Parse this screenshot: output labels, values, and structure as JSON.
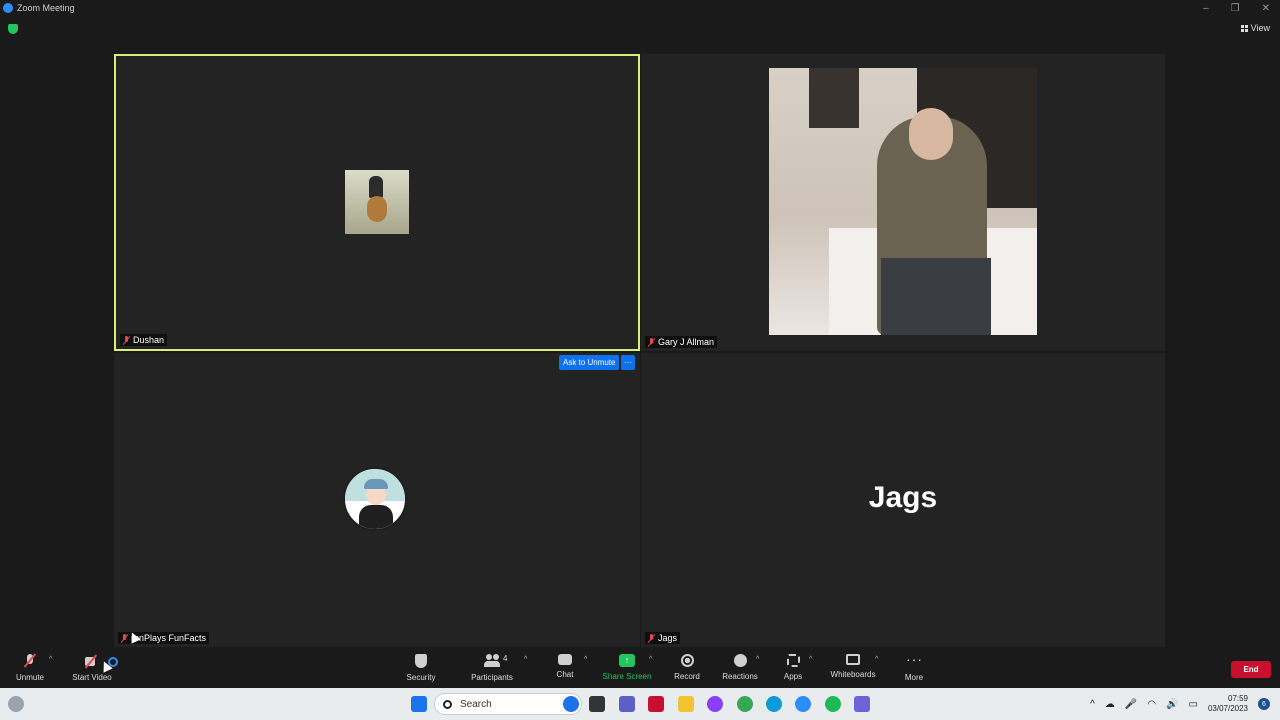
{
  "window": {
    "title": "Zoom Meeting",
    "minimize": "–",
    "maximize": "❐",
    "close": "✕"
  },
  "view_button": {
    "label": "View"
  },
  "participants_tiles": [
    {
      "name": "Dushan",
      "muted": true,
      "speaking": true
    },
    {
      "name": "Gary J Allman",
      "muted": true
    },
    {
      "name": "ronPlays FunFacts",
      "muted": true
    },
    {
      "name": "Jags",
      "muted": true,
      "display_name": "Jags"
    }
  ],
  "ask_to_unmute": "Ask to Unmute",
  "tile_more": "···",
  "toolbar": {
    "unmute": "Unmute",
    "start_video": "Start Video",
    "security": "Security",
    "participants": "Participants",
    "participants_count": "4",
    "chat": "Chat",
    "share_screen": "Share Screen",
    "record": "Record",
    "reactions": "Reactions",
    "apps": "Apps",
    "whiteboards": "Whiteboards",
    "more": "More",
    "more_glyph": "···",
    "caret": "^",
    "end": "End"
  },
  "taskbar": {
    "search_placeholder": "Search",
    "time": "07:59",
    "date": "03/07/2023",
    "notifications": "6",
    "tray_caret": "^"
  },
  "colors": {
    "speaker_border": "#d9ef7a",
    "share_green": "#22c55e",
    "end_red": "#c8102e",
    "zoom_blue": "#0e72ed"
  }
}
